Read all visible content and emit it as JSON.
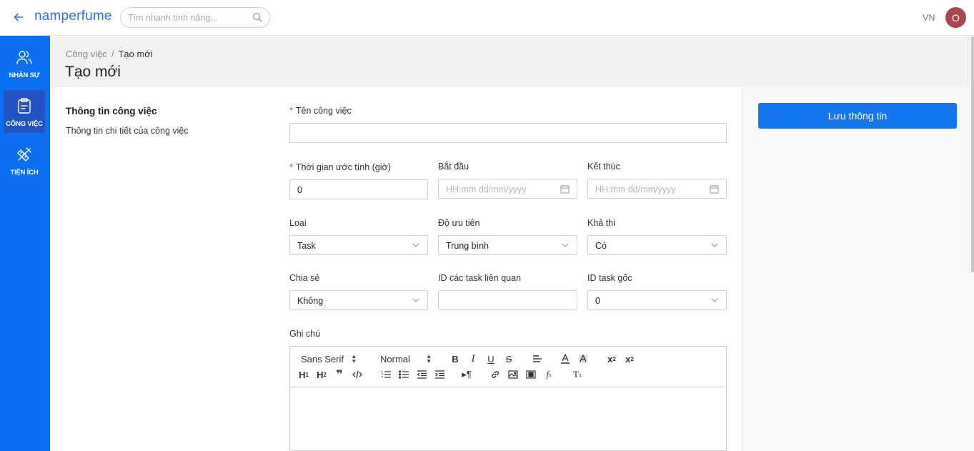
{
  "topbar": {
    "brand": "namperfume",
    "search_placeholder": "Tìm nhanh tính năng...",
    "language": "VN",
    "avatar_initial": "O"
  },
  "sidebar": {
    "items": [
      {
        "label": "NHÂN SỰ",
        "icon": "users-icon",
        "active": false
      },
      {
        "label": "CÔNG VIỆC",
        "icon": "clipboard-icon",
        "active": true
      },
      {
        "label": "TIỆN ÍCH",
        "icon": "tools-icon",
        "active": false
      }
    ]
  },
  "breadcrumb": {
    "parent": "Công việc",
    "separator": "/",
    "current": "Tạo mới"
  },
  "page_title": "Tạo mới",
  "section": {
    "title": "Thông tin công việc",
    "description": "Thông tin chi tiết của công việc"
  },
  "form": {
    "task_name": {
      "label": "Tên công việc",
      "required": true,
      "value": ""
    },
    "estimate": {
      "label": "Thời gian ước tính (giờ)",
      "required": true,
      "value": "0"
    },
    "start": {
      "label": "Bắt đầu",
      "placeholder": "HH:mm dd/mm/yyyy"
    },
    "end": {
      "label": "Kết thúc",
      "placeholder": "HH:mm dd/mm/yyyy"
    },
    "type": {
      "label": "Loại",
      "value": "Task"
    },
    "priority": {
      "label": "Độ ưu tiên",
      "value": "Trung bình"
    },
    "feasible": {
      "label": "Khả thi",
      "value": "Có"
    },
    "share": {
      "label": "Chia sẻ",
      "value": "Không"
    },
    "related_ids": {
      "label": "ID các task liên quan",
      "value": ""
    },
    "root_task": {
      "label": "ID task gốc",
      "value": "0"
    },
    "note": {
      "label": "Ghi chú"
    }
  },
  "editor": {
    "font_select": "Sans Serif",
    "size_select": "Normal",
    "toolbar_icons": [
      "bold-icon",
      "italic-icon",
      "underline-icon",
      "strike-icon",
      "align-icon",
      "text-color-icon",
      "background-color-icon",
      "superscript-icon",
      "subscript-icon",
      "header1-icon",
      "header2-icon",
      "blockquote-icon",
      "code-block-icon",
      "ordered-list-icon",
      "bullet-list-icon",
      "outdent-icon",
      "indent-icon",
      "rtl-direction-icon",
      "link-icon",
      "image-icon",
      "video-icon",
      "formula-icon",
      "clean-format-icon"
    ]
  },
  "actions": {
    "save_label": "Lưu thông tin"
  },
  "colors": {
    "sidebar": "#0b6ff4",
    "sidebar_active": "#2353c2",
    "primary_button": "#1477f0",
    "brand": "#2f6fde",
    "required": "#e0362f",
    "avatar": "#a8474e"
  }
}
